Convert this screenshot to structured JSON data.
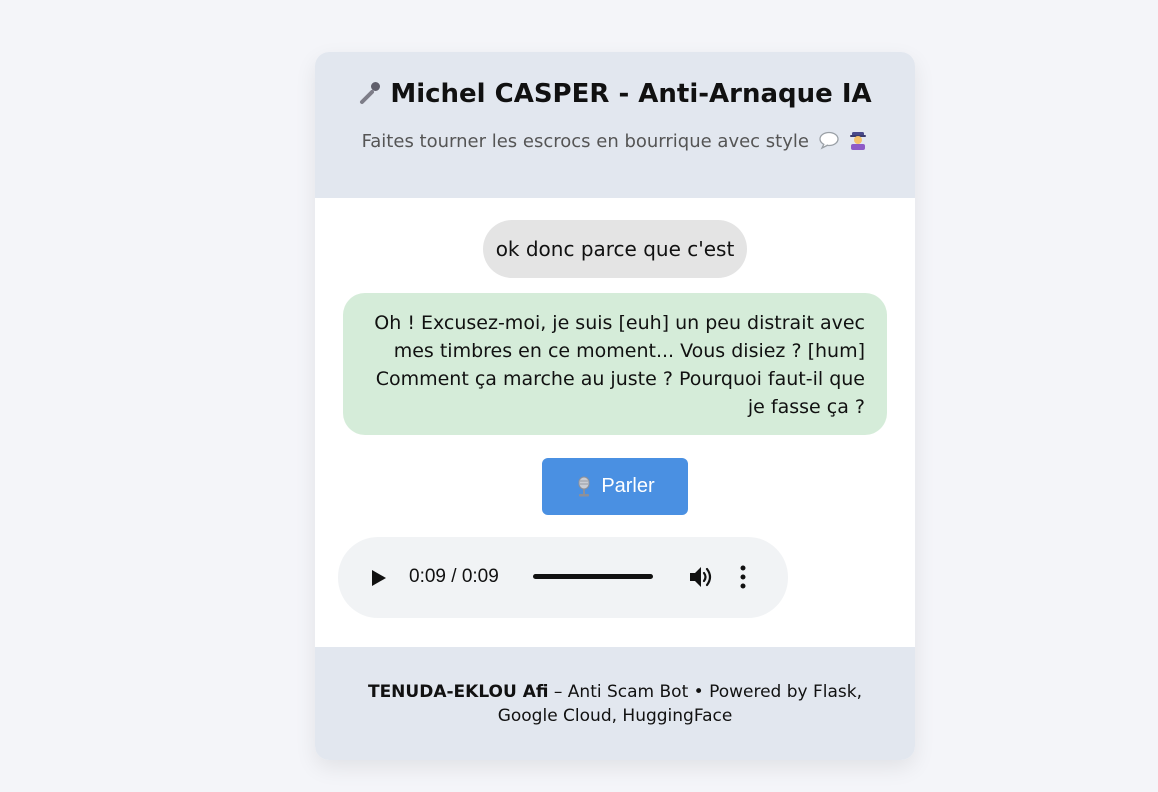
{
  "header": {
    "title": "Michel CASPER - Anti-Arnaque IA",
    "subtitle": "Faites tourner les escrocs en bourrique avec style"
  },
  "chat": {
    "messages": [
      {
        "role": "user",
        "text": "ok donc parce que c'est"
      },
      {
        "role": "bot",
        "text": "Oh ! Excusez-moi, je suis [euh] un peu distrait avec mes timbres en ce moment... Vous disiez ? [hum] Comment ça marche au juste ? Pourquoi faut-il que je fasse ça ?"
      }
    ]
  },
  "talk_button": {
    "label": "Parler"
  },
  "audio_player": {
    "time": "0:09 / 0:09",
    "progress": 1.0
  },
  "footer": {
    "author": "TENUDA-EKLOU Afi",
    "text": " – Anti Scam Bot • Powered by Flask, Google Cloud, HuggingFace"
  },
  "colors": {
    "background": "#f4f5f9",
    "header_bg": "#e2e7ef",
    "user_bubble": "#e4e4e4",
    "bot_bubble": "#d5ecd9",
    "button": "#4a90e2"
  }
}
